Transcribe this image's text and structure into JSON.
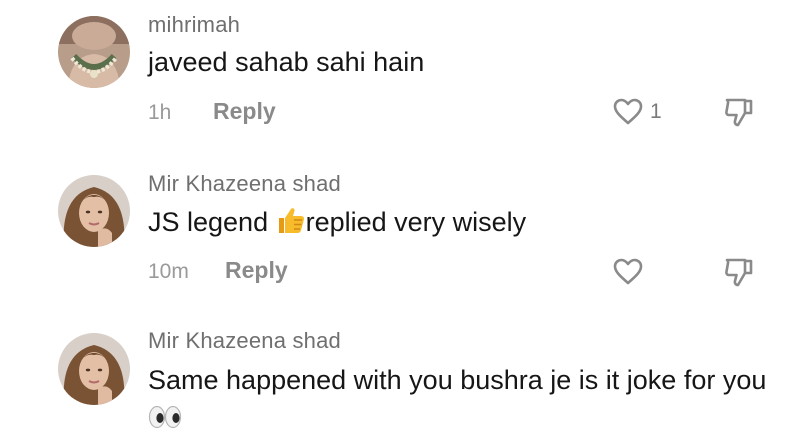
{
  "comments": [
    {
      "username": "mihrimah",
      "text": "javeed sahab sahi hain",
      "time": "1h",
      "reply_label": "Reply",
      "like_count": "1"
    },
    {
      "username": "Mir Khazeena shad",
      "text_before": "JS legend ",
      "emoji": "thumbs-up",
      "text_after": "replied very wisely",
      "time": "10m",
      "reply_label": "Reply",
      "like_count": ""
    },
    {
      "username": "Mir Khazeena shad",
      "text": "Same happened with you bushra je is it joke for you",
      "emoji": "eyes"
    }
  ],
  "colors": {
    "username": "#6f6f6f",
    "text": "#161616",
    "meta": "#9a9a9a",
    "icon": "#8a8a8a"
  },
  "icons": [
    "heart-icon",
    "dislike-icon",
    "thumbs-up-emoji",
    "eyes-emoji"
  ]
}
